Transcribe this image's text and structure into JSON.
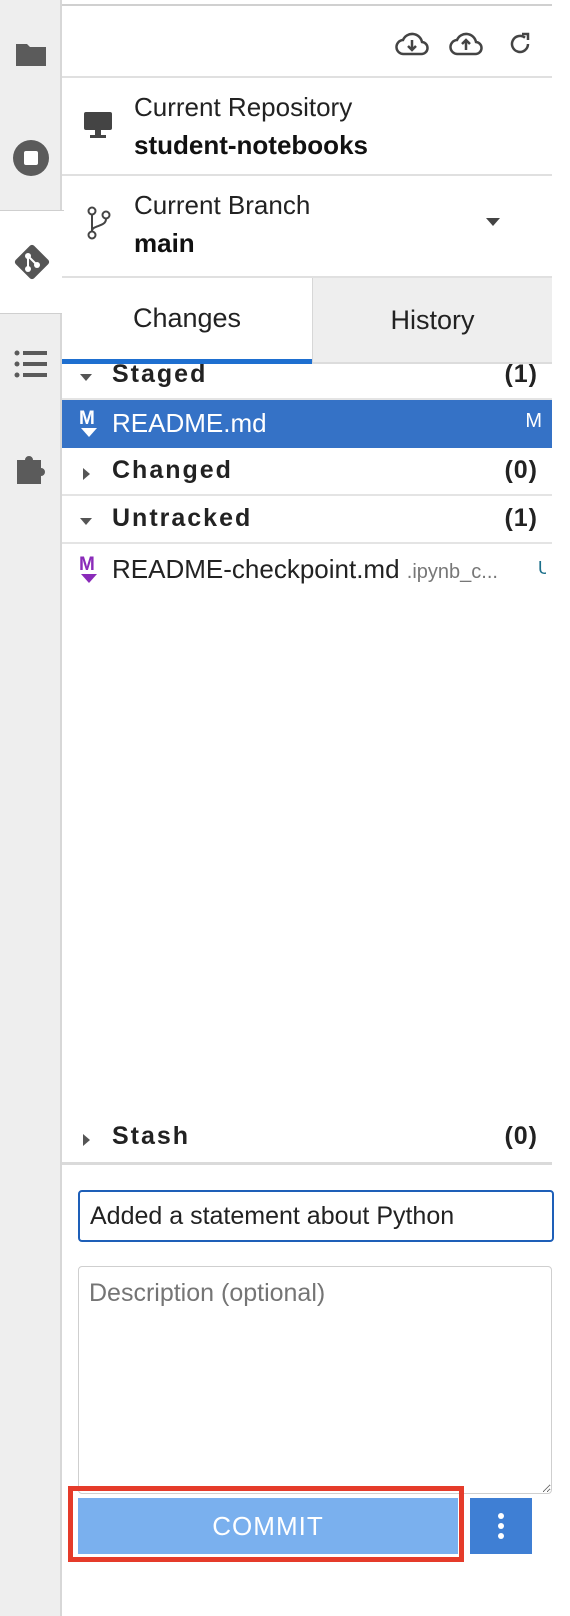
{
  "toolbar": {
    "pull_icon": "cloud-download-icon",
    "push_icon": "cloud-upload-icon",
    "refresh_icon": "refresh-icon"
  },
  "repository": {
    "label": "Current Repository",
    "value": "student-notebooks"
  },
  "branch": {
    "label": "Current Branch",
    "value": "main"
  },
  "tabs": [
    {
      "label": "Changes",
      "active": true
    },
    {
      "label": "History",
      "active": false
    }
  ],
  "staged": {
    "title": "Staged",
    "count": "(1)",
    "files": [
      {
        "name": "README.md",
        "path": "",
        "status": "M"
      }
    ]
  },
  "changed": {
    "title": "Changed",
    "count": "(0)"
  },
  "untracked": {
    "title": "Untracked",
    "count": "(1)",
    "files": [
      {
        "name": "README-checkpoint.md",
        "path": ".ipynb_c...",
        "status": "U"
      }
    ]
  },
  "stash": {
    "title": "Stash",
    "count": "(0)"
  },
  "commit": {
    "summary": "Added a statement about Python",
    "description_placeholder": "Description (optional)",
    "button_label": "COMMIT"
  },
  "colors": {
    "accent": "#1e6fd0",
    "selected_row": "#3572c6",
    "commit_button": "#7ab0ee",
    "highlight": "#e53b2a",
    "markdown_icon": "#8a2bb9"
  }
}
